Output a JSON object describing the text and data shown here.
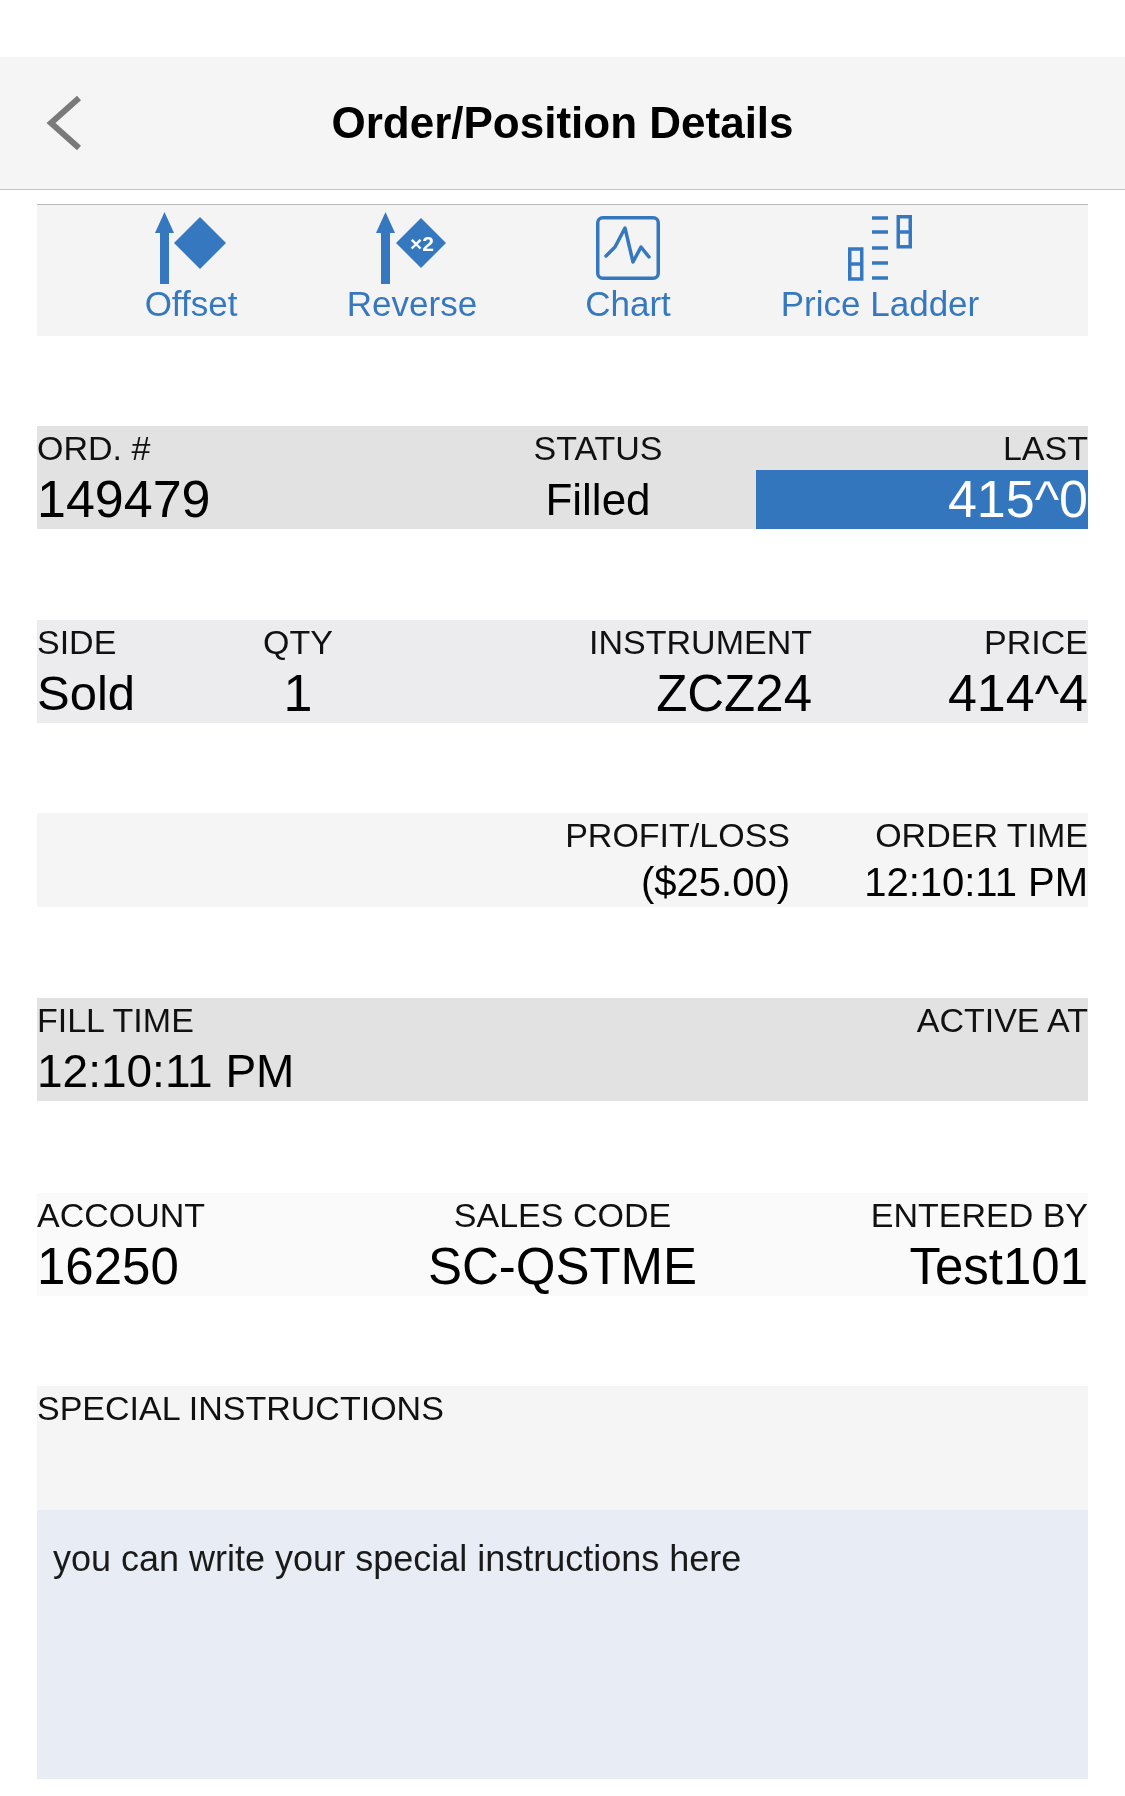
{
  "header": {
    "title": "Order/Position Details"
  },
  "toolbar": [
    {
      "kind": "offset",
      "label": "Offset"
    },
    {
      "kind": "reverse",
      "label": "Reverse",
      "icon_text": "×2"
    },
    {
      "kind": "chart",
      "label": "Chart"
    },
    {
      "kind": "ladder",
      "label": "Price Ladder"
    }
  ],
  "sections": [
    {
      "fields": [
        {
          "label": "ORD. #",
          "value": "149479",
          "highlighted": false
        },
        {
          "label": "STATUS",
          "value": "Filled",
          "highlighted": false
        },
        {
          "label": "LAST",
          "value": "415^0",
          "highlighted": true
        }
      ]
    },
    {
      "fields": [
        {
          "label": "SIDE",
          "value": "Sold"
        },
        {
          "label": "QTY",
          "value": "1"
        },
        {
          "label": "INSTRUMENT",
          "value": "ZCZ24"
        },
        {
          "label": "PRICE",
          "value": "414^4"
        }
      ]
    },
    {
      "fields": [
        {
          "label": "PROFIT/LOSS",
          "value": "($25.00)"
        },
        {
          "label": "ORDER TIME",
          "value": "12:10:11 PM"
        }
      ]
    },
    {
      "fields": [
        {
          "label": "FILL TIME",
          "value": "12:10:11 PM"
        },
        {
          "label": "ACTIVE AT"
        }
      ]
    },
    {
      "fields": [
        {
          "label": "ACCOUNT",
          "value": "16250"
        },
        {
          "label": "SALES CODE",
          "value": "SC-QSTME"
        },
        {
          "label": "ENTERED BY",
          "value": "Test101"
        }
      ]
    }
  ],
  "special_instructions": {
    "label": "SPECIAL INSTRUCTIONS",
    "value": "you can write your special instructions here"
  }
}
